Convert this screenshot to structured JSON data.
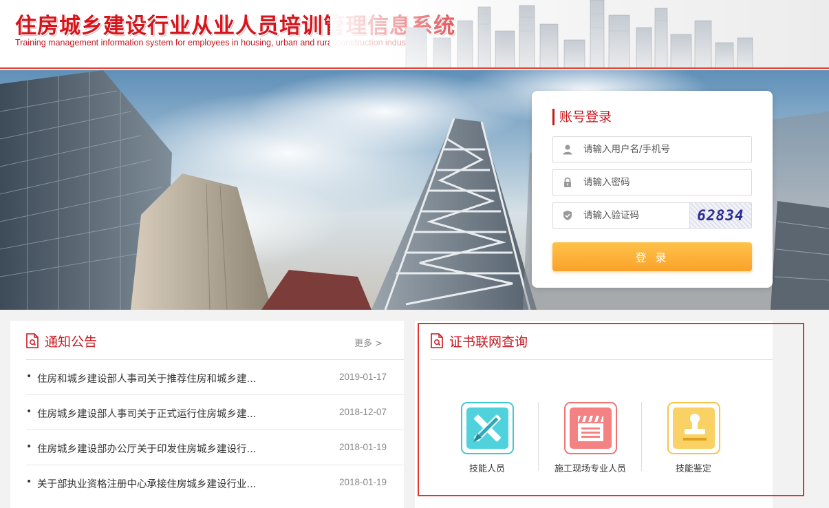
{
  "header": {
    "title": "住房城乡建设行业从业人员培训管理信息系统",
    "subtitle": "Training management information system for employees in housing, urban and rural construction industry"
  },
  "login": {
    "title": "账号登录",
    "username_placeholder": "请输入用户名/手机号",
    "password_placeholder": "请输入密码",
    "captcha_placeholder": "请输入验证码",
    "captcha_text": "62834",
    "submit_label": "登 录"
  },
  "notice": {
    "title": "通知公告",
    "more": "更多 >",
    "items": [
      {
        "title": "住房和城乡建设部人事司关于推荐住房和城乡建...",
        "date": "2019-01-17"
      },
      {
        "title": "住房城乡建设部人事司关于正式运行住房城乡建...",
        "date": "2018-12-07"
      },
      {
        "title": "住房城乡建设部办公厅关于印发住房城乡建设行...",
        "date": "2018-01-19"
      },
      {
        "title": "关于部执业资格注册中心承接住房城乡建设行业...",
        "date": "2018-01-19"
      }
    ]
  },
  "cert": {
    "title": "证书联网查询",
    "items": [
      {
        "label": "技能人员",
        "icon": "tools-icon",
        "color": "#3ec8d3"
      },
      {
        "label": "施工现场专业人员",
        "icon": "clapperboard-icon",
        "color": "#f07474"
      },
      {
        "label": "技能鉴定",
        "icon": "stamp-icon",
        "color": "#f6c54a"
      }
    ]
  },
  "colors": {
    "brand_red": "#c8161d",
    "login_button": "#f9a22a",
    "highlight_border": "#e8302c"
  }
}
